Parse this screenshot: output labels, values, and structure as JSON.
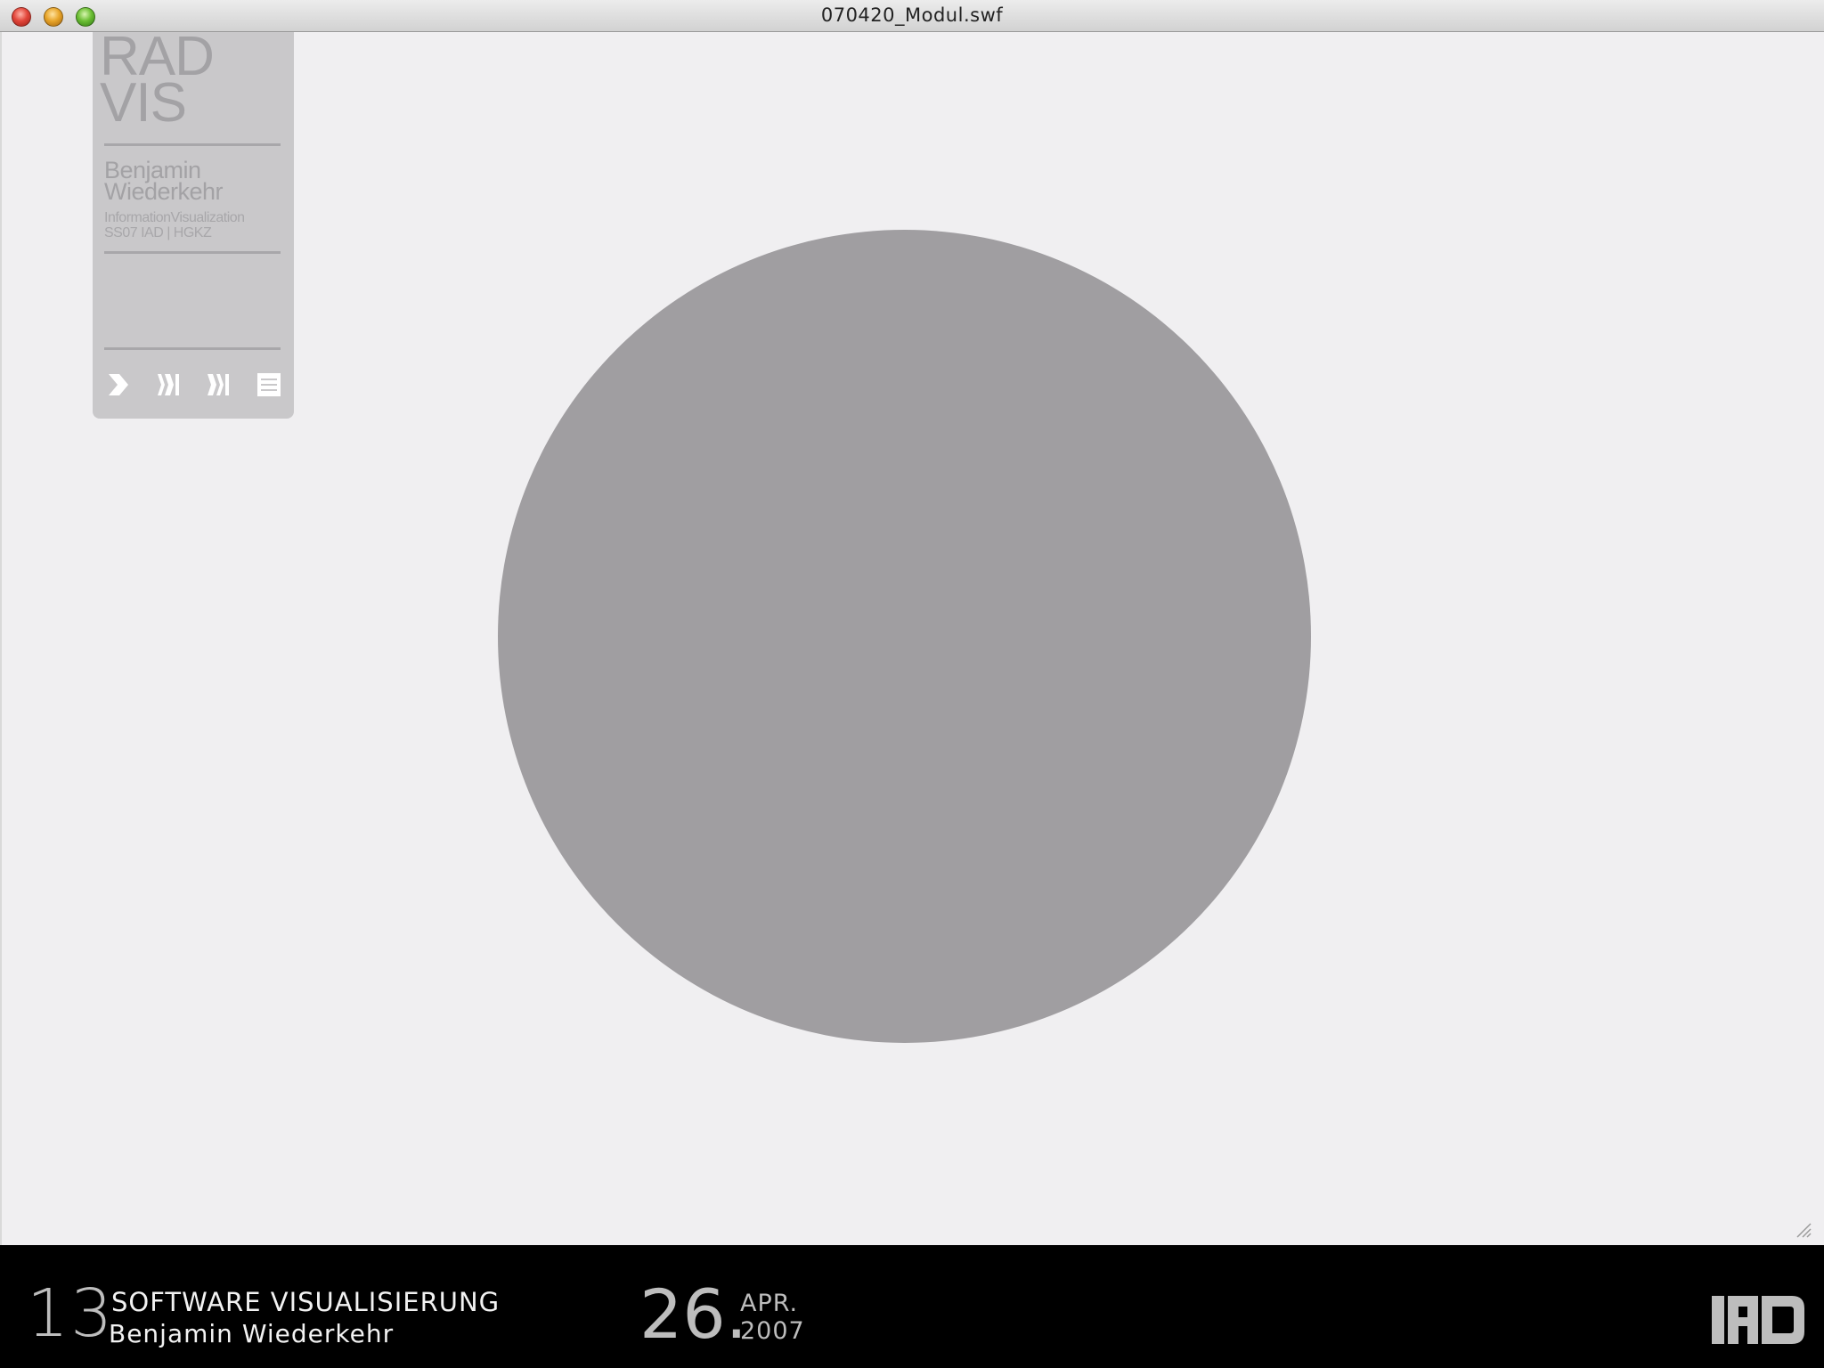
{
  "window": {
    "title": "070420_Modul.swf"
  },
  "panel": {
    "logo_line1": "RAD",
    "logo_line2": "VIS",
    "author_line1": "Benjamin",
    "author_line2": "Wiederkehr",
    "course_line1": "InformationVisualization",
    "course_line2": "SS07 IAD | HGKZ",
    "controls": [
      "play-icon",
      "step-icon",
      "skip-icon",
      "menu-icon"
    ]
  },
  "stage": {
    "circle_color": "#a09ea1",
    "background": "#f0eff1"
  },
  "footer": {
    "episode_number": "13",
    "episode_title": "SOFTWARE VISUALISIERUNG",
    "speaker": "Benjamin Wiederkehr",
    "day": "26.",
    "month": "APR.",
    "year": "2007",
    "brand": "IAD"
  }
}
